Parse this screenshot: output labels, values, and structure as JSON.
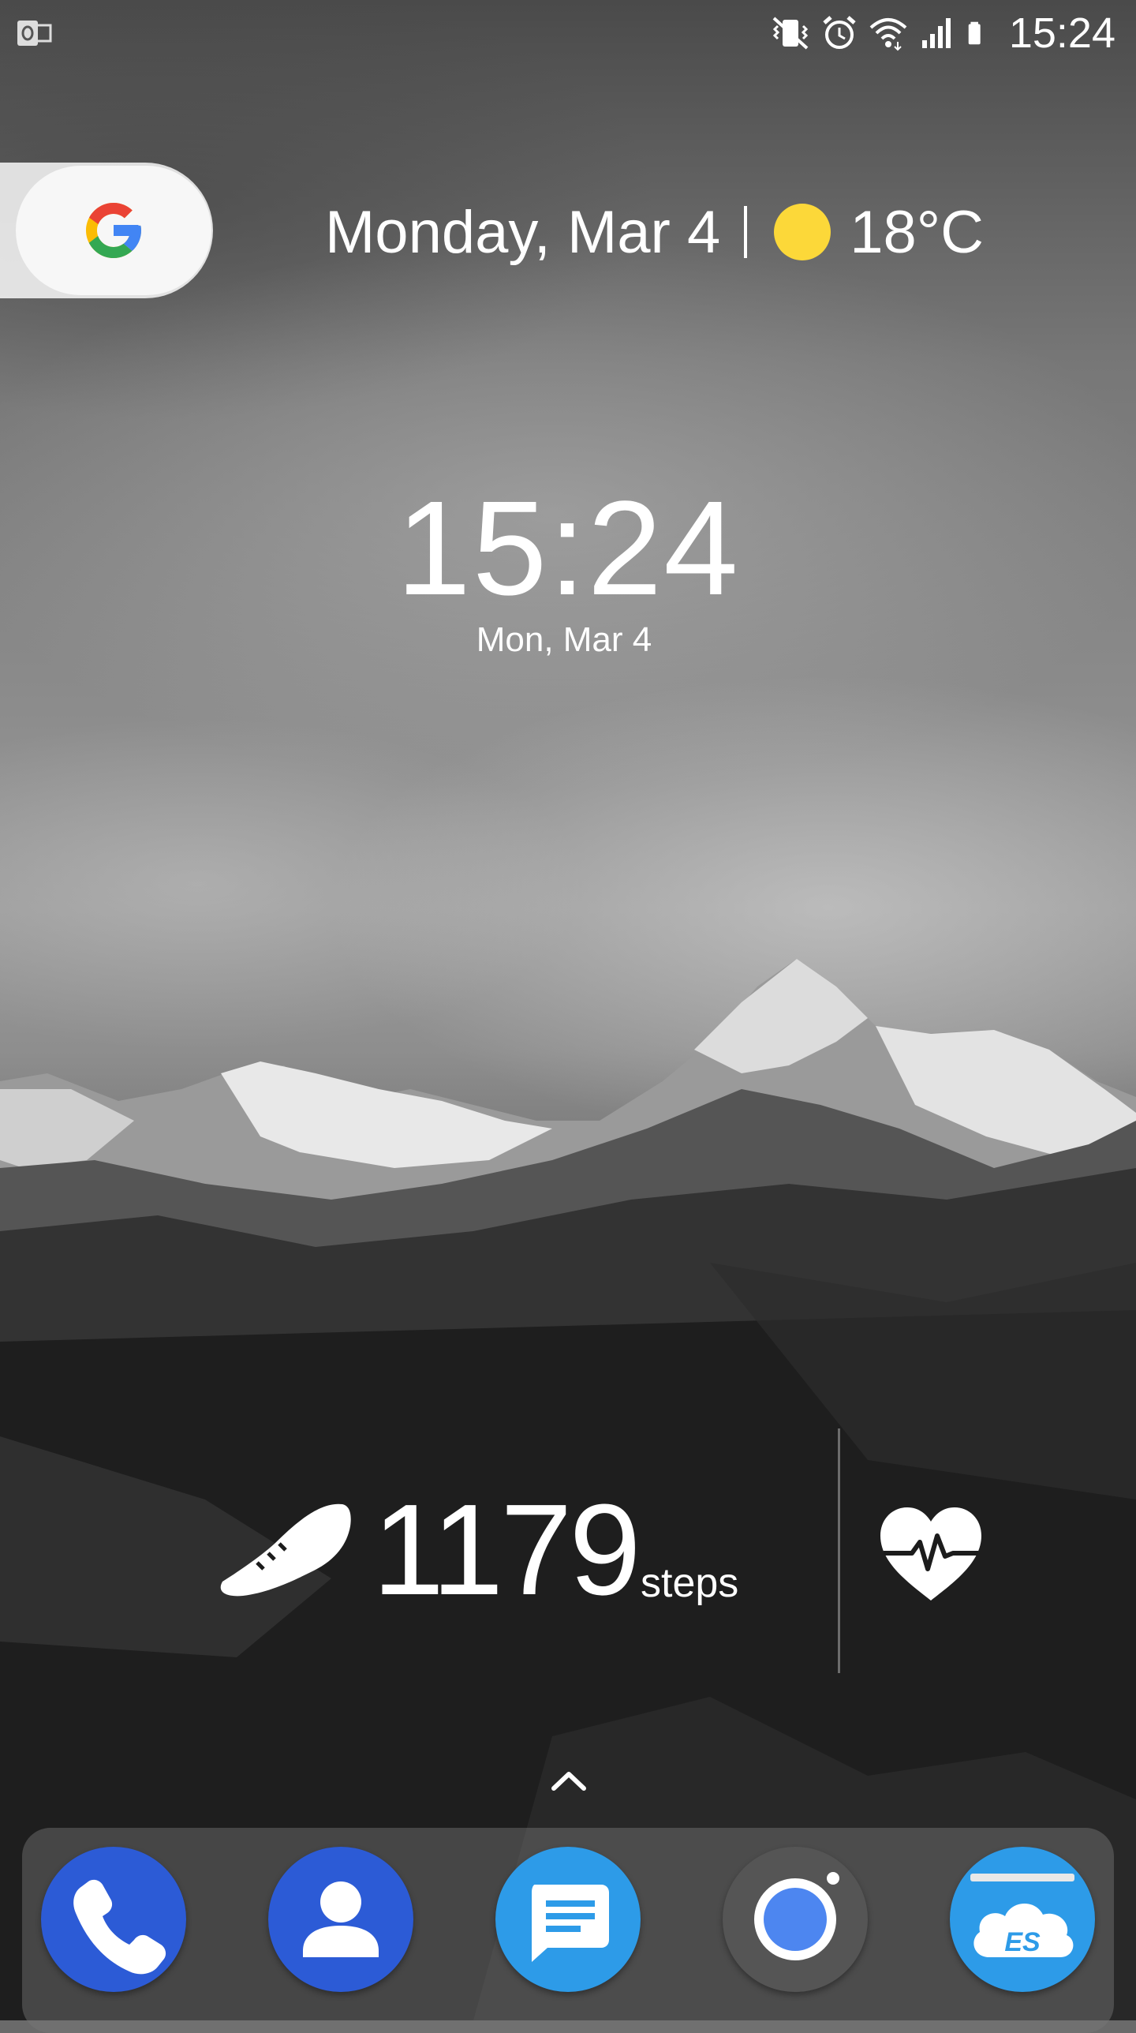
{
  "status_bar": {
    "time": "15:24",
    "icons": [
      "outlook-notification-icon",
      "vibrate-icon",
      "alarm-icon",
      "wifi-icon",
      "signal-icon",
      "battery-icon"
    ]
  },
  "google_widget": {
    "icon": "google-g-icon"
  },
  "at_a_glance": {
    "date": "Monday, Mar 4",
    "weather_icon": "sun-icon",
    "temperature": "18°C"
  },
  "clock_widget": {
    "time": "15:24",
    "date": "Mon, Mar 4"
  },
  "health_widget": {
    "steps_icon": "shoe-icon",
    "steps": "1179",
    "steps_label": "steps",
    "heart_icon": "heart-rate-icon"
  },
  "app_drawer": {
    "icon": "chevron-up-icon"
  },
  "dock": {
    "apps": [
      {
        "name": "Phone",
        "icon": "phone-icon",
        "color": "#2c5bd6"
      },
      {
        "name": "Contacts",
        "icon": "contacts-icon",
        "color": "#2c5bd6"
      },
      {
        "name": "Messages",
        "icon": "messages-icon",
        "color": "#2d9be8"
      },
      {
        "name": "Camera",
        "icon": "camera-icon",
        "color": "#555555"
      },
      {
        "name": "ES File Explorer",
        "icon": "es-file-explorer-icon",
        "color": "#2d9be8"
      }
    ]
  },
  "colors": {
    "sun": "#fcd839",
    "google_blue": "#4285F4",
    "google_red": "#EA4335",
    "google_yellow": "#FBBC05",
    "google_green": "#34A853"
  }
}
